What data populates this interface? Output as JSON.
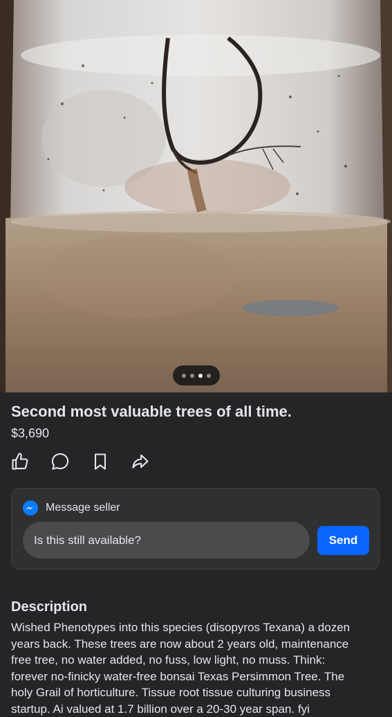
{
  "carousel": {
    "count": 4,
    "active_index": 2
  },
  "listing": {
    "title": "Second most valuable trees of all time.",
    "price": "$3,690"
  },
  "actions": [
    {
      "name": "like",
      "icon": "thumbs-up-icon"
    },
    {
      "name": "comment",
      "icon": "speech-bubble-icon"
    },
    {
      "name": "save",
      "icon": "bookmark-icon"
    },
    {
      "name": "share",
      "icon": "share-arrow-icon"
    }
  ],
  "message": {
    "header": "Message seller",
    "icon": "messenger-icon",
    "input_value": "Is this still available?",
    "send_label": "Send"
  },
  "description": {
    "heading": "Description",
    "lines": [
      "Wished Phenotypes into this species (disopyros Texana) a dozen",
      "years back. These trees are now about 2 years old, maintenance",
      "free tree, no water added, no fuss, low light, no muss. Think:",
      "forever no-finicky water-free bonsai Texas Persimmon Tree. The",
      "holy Grail of horticulture. Tissue root tissue culturing business",
      "startup. Ai valued at 1.7 billion over a 20-30 year span. fyi"
    ]
  },
  "colors": {
    "background": "#242526",
    "card": "#2f3031",
    "accent": "#0866ff",
    "text": "#e4e6eb"
  }
}
